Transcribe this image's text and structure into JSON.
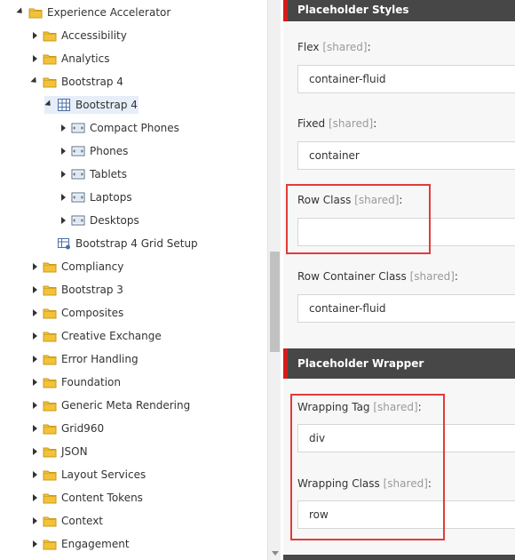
{
  "tree": {
    "items": [
      {
        "label": "Experience Accelerator",
        "icon": "folder-icon",
        "state": "expanded"
      },
      {
        "label": "Accessibility",
        "icon": "folder-icon",
        "state": "collapsed"
      },
      {
        "label": "Analytics",
        "icon": "folder-icon",
        "state": "collapsed"
      },
      {
        "label": "Bootstrap 4",
        "icon": "folder-icon",
        "state": "expanded"
      },
      {
        "label": "Bootstrap 4",
        "icon": "grid-icon",
        "state": "expanded",
        "selected": true
      },
      {
        "label": "Compact Phones",
        "icon": "device-icon",
        "state": "collapsed"
      },
      {
        "label": "Phones",
        "icon": "device-icon",
        "state": "collapsed"
      },
      {
        "label": "Tablets",
        "icon": "device-icon",
        "state": "collapsed"
      },
      {
        "label": "Laptops",
        "icon": "device-icon",
        "state": "collapsed"
      },
      {
        "label": "Desktops",
        "icon": "device-icon",
        "state": "collapsed"
      },
      {
        "label": "Bootstrap 4 Grid Setup",
        "icon": "grid-setup-icon",
        "state": "leaf"
      },
      {
        "label": "Compliancy",
        "icon": "folder-icon",
        "state": "collapsed"
      },
      {
        "label": "Bootstrap 3",
        "icon": "folder-icon",
        "state": "collapsed"
      },
      {
        "label": "Composites",
        "icon": "folder-icon",
        "state": "collapsed"
      },
      {
        "label": "Creative Exchange",
        "icon": "folder-icon",
        "state": "collapsed"
      },
      {
        "label": "Error Handling",
        "icon": "folder-icon",
        "state": "collapsed"
      },
      {
        "label": "Foundation",
        "icon": "folder-icon",
        "state": "collapsed"
      },
      {
        "label": "Generic Meta Rendering",
        "icon": "folder-icon",
        "state": "collapsed"
      },
      {
        "label": "Grid960",
        "icon": "folder-icon",
        "state": "collapsed"
      },
      {
        "label": "JSON",
        "icon": "folder-icon",
        "state": "collapsed"
      },
      {
        "label": "Layout Services",
        "icon": "folder-icon",
        "state": "collapsed"
      },
      {
        "label": "Content Tokens",
        "icon": "folder-icon",
        "state": "collapsed"
      },
      {
        "label": "Context",
        "icon": "folder-icon",
        "state": "collapsed"
      },
      {
        "label": "Engagement",
        "icon": "folder-icon",
        "state": "collapsed"
      }
    ]
  },
  "panel": {
    "placeholder_styles": {
      "title": "Placeholder Styles",
      "flex": {
        "label": "Flex",
        "shared": "[shared]",
        "colon": ":",
        "value": "container-fluid"
      },
      "fixed": {
        "label": "Fixed",
        "shared": "[shared]",
        "colon": ":",
        "value": "container"
      },
      "row_class": {
        "label": "Row Class",
        "shared": "[shared]",
        "colon": ":",
        "value": ""
      },
      "row_container_class": {
        "label": "Row Container Class",
        "shared": "[shared]",
        "colon": ":",
        "value": "container-fluid"
      }
    },
    "placeholder_wrapper": {
      "title": "Placeholder Wrapper",
      "wrapping_tag": {
        "label": "Wrapping Tag",
        "shared": "[shared]",
        "colon": ":",
        "value": "div"
      },
      "wrapping_class": {
        "label": "Wrapping Class",
        "shared": "[shared]",
        "colon": ":",
        "value": "row"
      }
    }
  },
  "colors": {
    "section_header": "#474747",
    "section_accent": "#d71a1a",
    "highlight_box": "#e23b3b",
    "folder": "#f2c23a",
    "selected_row": "#e6eef9"
  }
}
